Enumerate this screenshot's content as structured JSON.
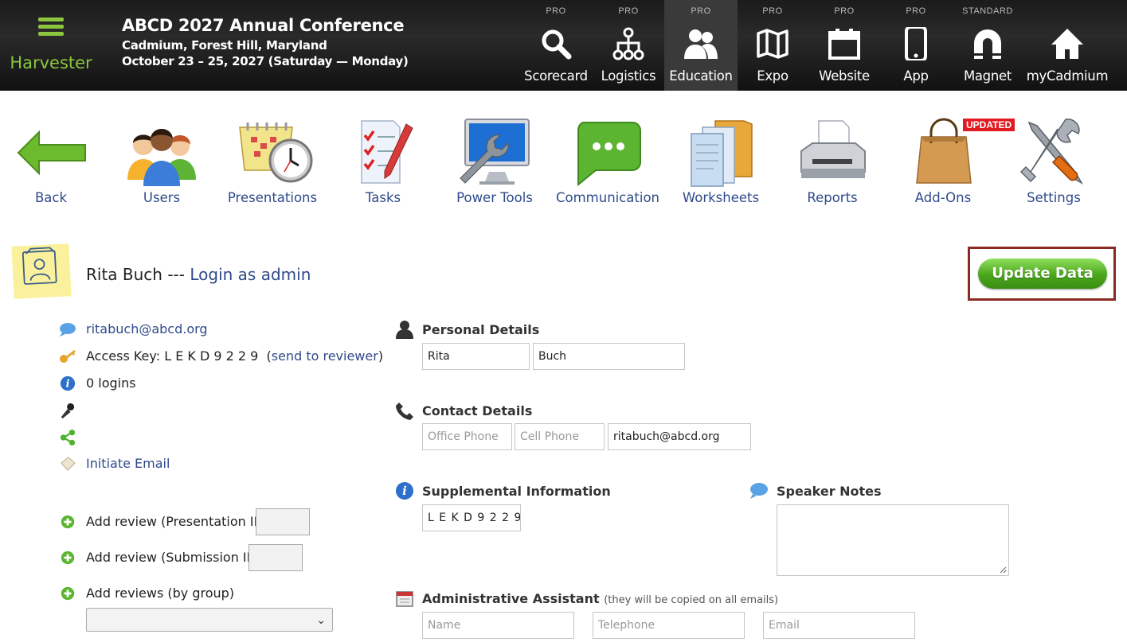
{
  "app": {
    "name": "Harvester"
  },
  "conference": {
    "title": "ABCD 2027 Annual Conference",
    "location": "Cadmium, Forest Hill, Maryland",
    "dates": "October 23 – 25, 2027 (Saturday — Monday)"
  },
  "nav": [
    {
      "tier": "PRO",
      "label": "Scorecard",
      "icon": "search-icon"
    },
    {
      "tier": "PRO",
      "label": "Logistics",
      "icon": "hierarchy-icon"
    },
    {
      "tier": "PRO",
      "label": "Education",
      "icon": "people-icon",
      "active": true
    },
    {
      "tier": "PRO",
      "label": "Expo",
      "icon": "map-icon"
    },
    {
      "tier": "PRO",
      "label": "Website",
      "icon": "calendar-icon"
    },
    {
      "tier": "PRO",
      "label": "App",
      "icon": "phone-icon"
    },
    {
      "tier": "STANDARD",
      "label": "Magnet",
      "icon": "magnet-icon"
    },
    {
      "tier": "",
      "label": "myCadmium",
      "icon": "home-icon"
    }
  ],
  "tools": [
    {
      "label": "Back"
    },
    {
      "label": "Users"
    },
    {
      "label": "Presentations"
    },
    {
      "label": "Tasks"
    },
    {
      "label": "Power Tools"
    },
    {
      "label": "Communication"
    },
    {
      "label": "Worksheets"
    },
    {
      "label": "Reports"
    },
    {
      "label": "Add-Ons",
      "badge": "UPDATED"
    },
    {
      "label": "Settings"
    }
  ],
  "user": {
    "name": "Rita Buch",
    "separator": "---",
    "login_link": "Login as admin",
    "update_button": "Update Data",
    "email": "ritabuch@abcd.org",
    "access_key_label": "Access Key:",
    "access_key": "L E K D 9 2 2 9",
    "send_to_reviewer": "send to reviewer",
    "logins": "0 logins",
    "initiate_email": "Initiate Email",
    "add_review_presentation": "Add review (Presentation ID)",
    "add_review_submission": "Add review (Submission ID)",
    "add_reviews_group": "Add reviews (by group)"
  },
  "personal": {
    "title": "Personal Details",
    "first": "Rita",
    "last": "Buch"
  },
  "contact": {
    "title": "Contact Details",
    "office_ph": "Office Phone",
    "cell_ph": "Cell Phone",
    "email": "ritabuch@abcd.org"
  },
  "supplemental": {
    "title": "Supplemental Information",
    "value": "L E K D 9 2 2 9"
  },
  "speaker_notes": {
    "title": "Speaker Notes"
  },
  "admin": {
    "title": "Administrative Assistant",
    "note": "(they will be copied on all emails)",
    "name_ph": "Name",
    "tel_ph": "Telephone",
    "email_ph": "Email"
  },
  "colors": {
    "accent_green": "#8cc63f",
    "link_blue": "#2f4a8a",
    "update_green": "#4aa51c",
    "badge_red": "#e01b24"
  }
}
